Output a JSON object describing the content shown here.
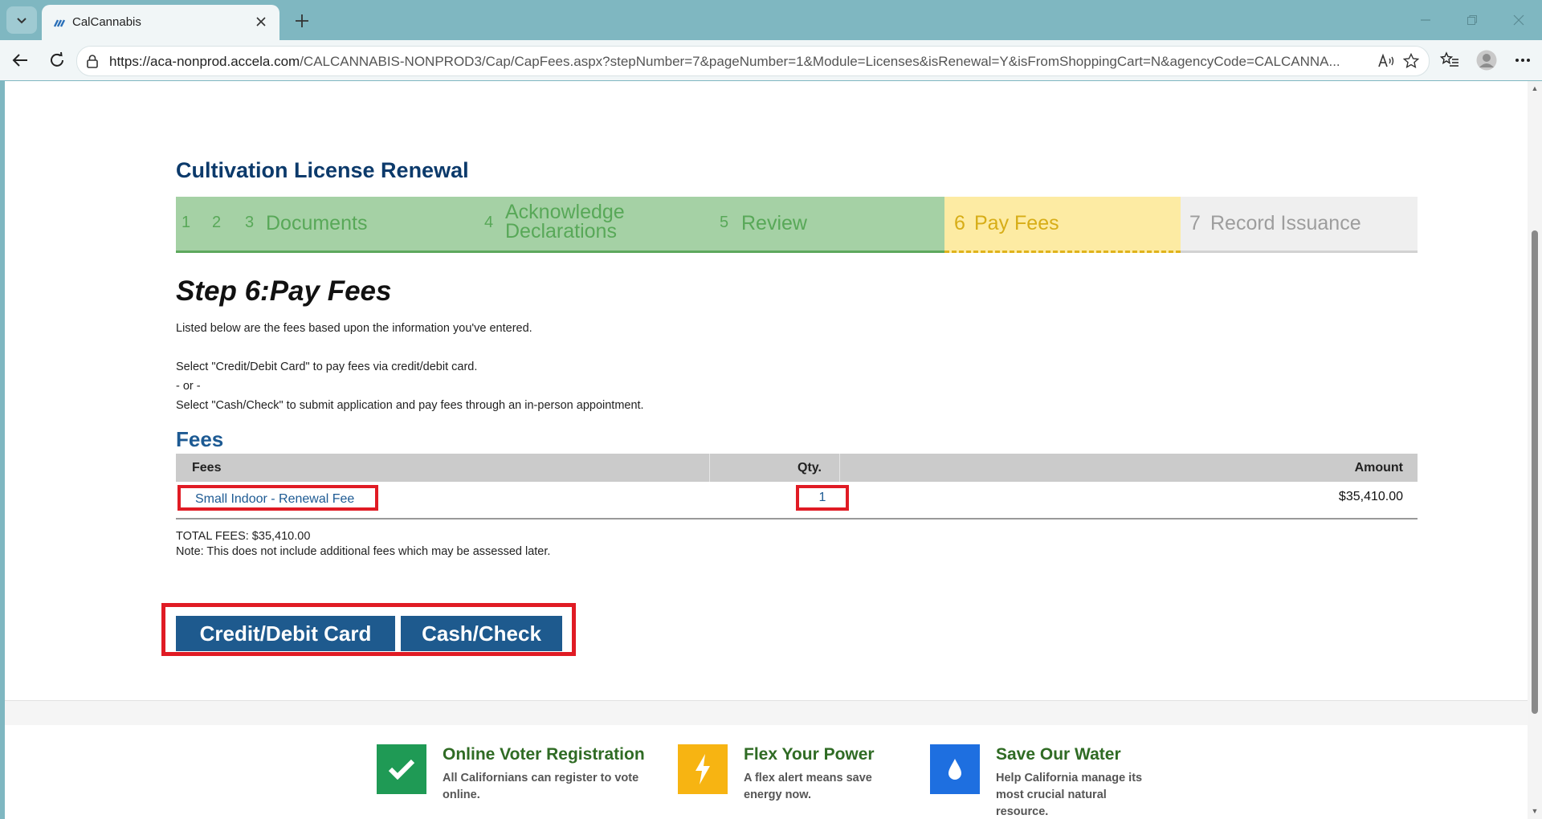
{
  "browser": {
    "tab_title": "CalCannabis",
    "url_host": "https://aca-nonprod.accela.com",
    "url_path": "/CALCANNABIS-NONPROD3/Cap/CapFees.aspx?stepNumber=7&pageNumber=1&Module=Licenses&isRenewal=Y&isFromShoppingCart=N&agencyCode=CALCANNA..."
  },
  "page": {
    "title": "Cultivation License Renewal",
    "steps": [
      {
        "num": "1",
        "label": ""
      },
      {
        "num": "2",
        "label": ""
      },
      {
        "num": "3",
        "label": "Documents"
      },
      {
        "num": "4",
        "label_line1": "Acknowledge",
        "label_line2": "Declarations"
      },
      {
        "num": "5",
        "label": "Review"
      },
      {
        "num": "6",
        "label": "Pay Fees"
      },
      {
        "num": "7",
        "label": "Record Issuance"
      }
    ],
    "step_heading": "Step 6:Pay Fees",
    "intro": "Listed below are the fees based upon the information you've entered.",
    "option_card": "Select \"Credit/Debit Card\" to pay fees via credit/debit card.",
    "option_or": "- or -",
    "option_cash": "Select \"Cash/Check\" to submit application and pay fees through an in-person appointment.",
    "fees_heading": "Fees",
    "fees_table": {
      "headers": {
        "fees": "Fees",
        "qty": "Qty.",
        "amount": "Amount"
      },
      "rows": [
        {
          "name": "Small Indoor - Renewal Fee",
          "qty": "1",
          "amount": "$35,410.00"
        }
      ]
    },
    "total": "TOTAL FEES: $35,410.00",
    "note": "Note: This does not include additional fees which may be assessed later.",
    "buttons": {
      "card": "Credit/Debit Card",
      "cash": "Cash/Check"
    }
  },
  "footer": {
    "promos": [
      {
        "title": "Online Voter Registration",
        "line1": "All Californians can register to vote",
        "line2": "online.",
        "icon": "checkmark-icon",
        "color": "#1f9a55"
      },
      {
        "title": "Flex Your Power",
        "line1": "A flex alert means save",
        "line2": "energy now.",
        "icon": "lightning-icon",
        "color": "#f7b412"
      },
      {
        "title": "Save Our Water",
        "line1": "Help California manage its",
        "line2": "most crucial natural",
        "line3": "resource.",
        "icon": "water-drop-icon",
        "color": "#1e6fe0"
      }
    ]
  },
  "colors": {
    "accent": "#1e5a8e",
    "title": "#0c3a6b",
    "highlight": "#e01b24",
    "step_done": "#a5d1a5",
    "step_current": "#fdeba3"
  }
}
